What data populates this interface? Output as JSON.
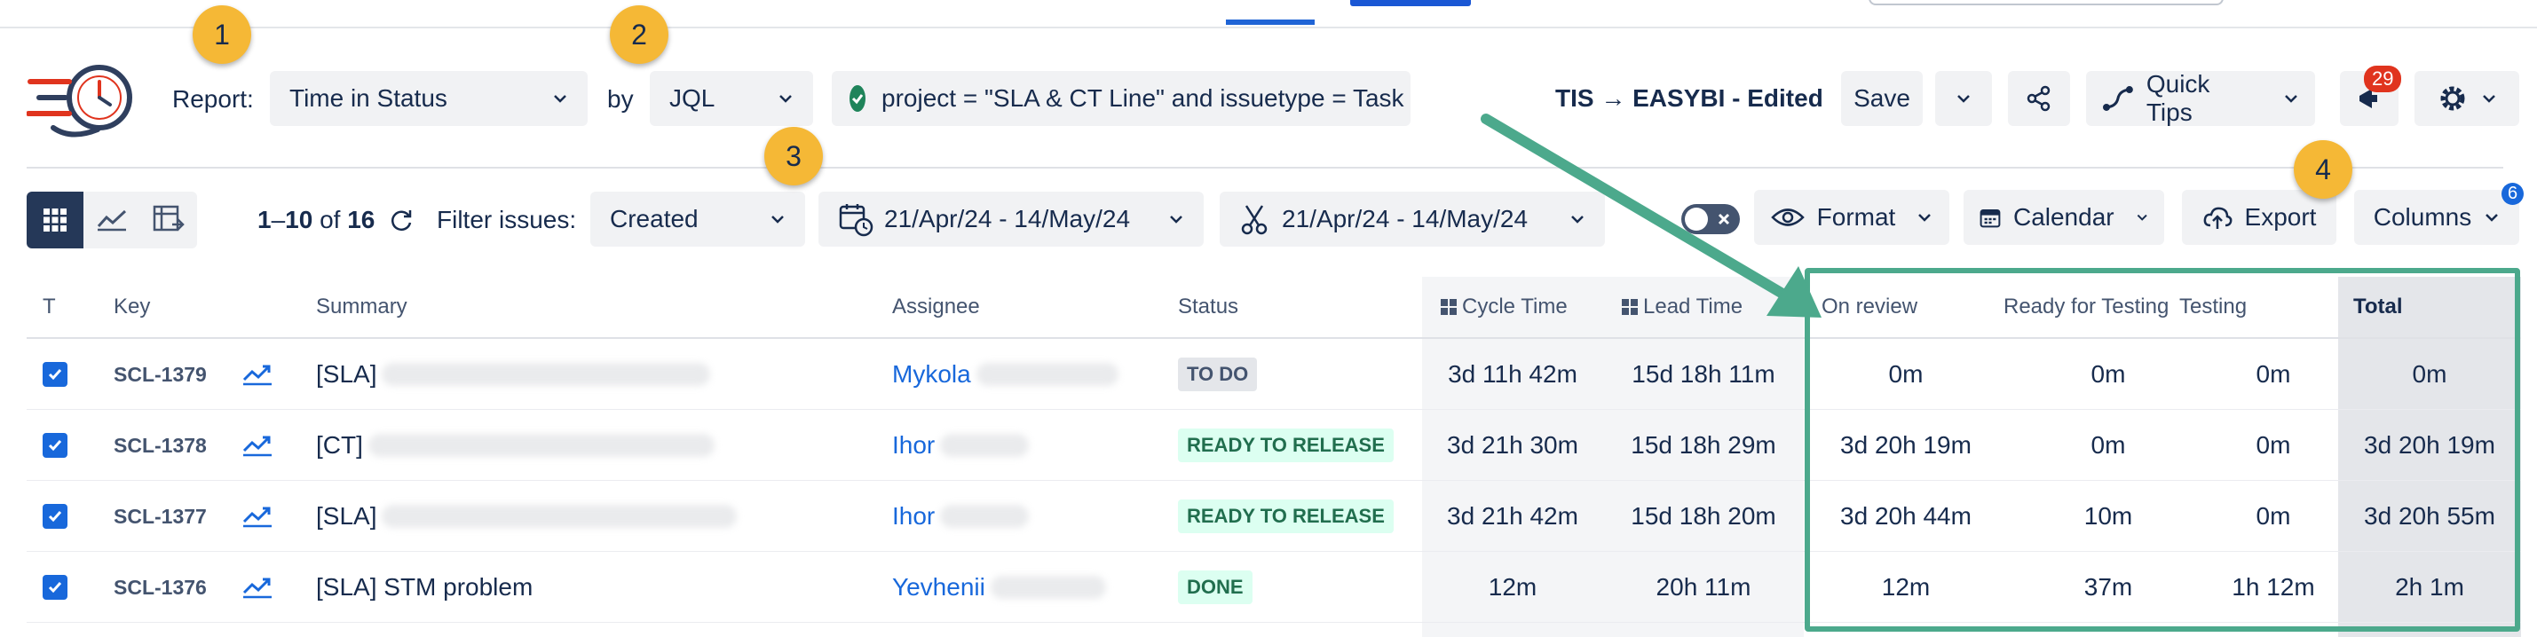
{
  "header": {
    "report_label": "Report:",
    "report_value": "Time in Status",
    "by_label": "by",
    "by_value": "JQL",
    "jql_query": "project = \"SLA & CT Line\" and issuetype = Task",
    "report_title": "TIS → EASYBI - Edited",
    "save_label": "Save",
    "quick_tips_label": "Quick Tips",
    "notifications_count": "29"
  },
  "toolbar": {
    "range_start": "1",
    "range_end": "10",
    "total": "16",
    "count_sep1": "–",
    "count_of": " of ",
    "filter_label": "Filter issues:",
    "filter_value": "Created",
    "date_range": "21/Apr/24 - 14/May/24",
    "cut_range": "21/Apr/24 - 14/May/24",
    "format_label": "Format",
    "calendar_label": "Calendar",
    "export_label": "Export",
    "columns_label": "Columns",
    "columns_badge": "6"
  },
  "callouts": [
    "1",
    "2",
    "3",
    "4"
  ],
  "table": {
    "columns": {
      "t": "T",
      "key": "Key",
      "summary": "Summary",
      "assignee": "Assignee",
      "status": "Status",
      "cycle_time": "Cycle Time",
      "lead_time": "Lead Time",
      "on_review": "On review",
      "ready_testing": "Ready for Testing",
      "testing": "Testing",
      "total": "Total"
    },
    "rows": [
      {
        "key": "SCL-1379",
        "summary": "[SLA]",
        "assignee": "Mykola",
        "status": "TO DO",
        "cycle": "3d 11h 42m",
        "lead": "15d 18h 11m",
        "review": "0m",
        "ready": "0m",
        "testing": "0m",
        "total": "0m"
      },
      {
        "key": "SCL-1378",
        "summary": "[CT]",
        "assignee": "Ihor",
        "status": "READY TO RELEASE",
        "cycle": "3d 21h 30m",
        "lead": "15d 18h 29m",
        "review": "3d 20h 19m",
        "ready": "0m",
        "testing": "0m",
        "total": "3d 20h 19m"
      },
      {
        "key": "SCL-1377",
        "summary": "[SLA]",
        "assignee": "Ihor",
        "status": "READY TO RELEASE",
        "cycle": "3d 21h 42m",
        "lead": "15d 18h 20m",
        "review": "3d 20h 44m",
        "ready": "10m",
        "testing": "0m",
        "total": "3d 20h 55m"
      },
      {
        "key": "SCL-1376",
        "summary": "[SLA] STM problem",
        "assignee": "Yevhenii",
        "status": "DONE",
        "cycle": "12m",
        "lead": "20h 11m",
        "review": "12m",
        "ready": "37m",
        "testing": "1h 12m",
        "total": "2h 1m"
      }
    ]
  },
  "colors": {
    "accent": "#1868db",
    "highlight": "#4ca98c",
    "callout": "#f5b836"
  }
}
